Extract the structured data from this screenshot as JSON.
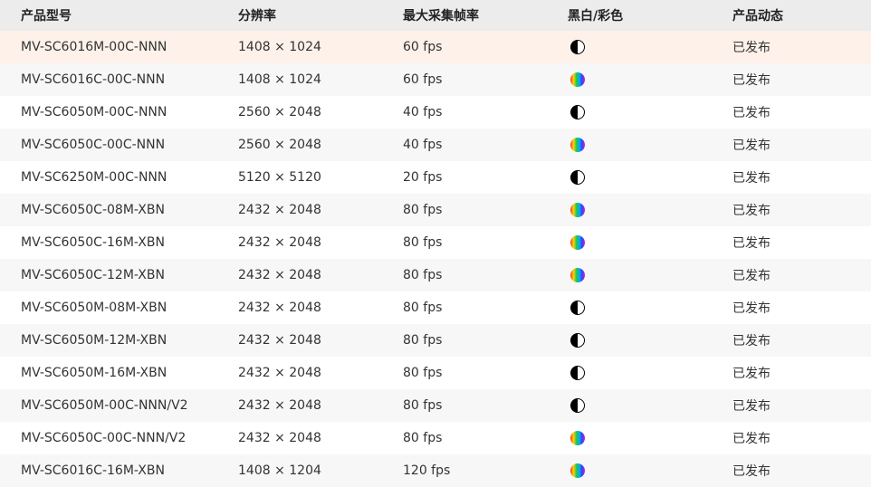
{
  "table": {
    "headers": {
      "model": "产品型号",
      "resolution": "分辨率",
      "fps": "最大采集帧率",
      "mode": "黑白/彩色",
      "status": "产品动态"
    },
    "rows": [
      {
        "model": "MV-SC6016M-00C-NNN",
        "resolution": "1408 × 1024",
        "fps": "60 fps",
        "mode_icon": "mono-icon",
        "status": "已发布"
      },
      {
        "model": "MV-SC6016C-00C-NNN",
        "resolution": "1408 × 1024",
        "fps": "60 fps",
        "mode_icon": "color-icon",
        "status": "已发布"
      },
      {
        "model": "MV-SC6050M-00C-NNN",
        "resolution": "2560 × 2048",
        "fps": "40 fps",
        "mode_icon": "mono-icon",
        "status": "已发布"
      },
      {
        "model": "MV-SC6050C-00C-NNN",
        "resolution": "2560 × 2048",
        "fps": "40 fps",
        "mode_icon": "color-icon",
        "status": "已发布"
      },
      {
        "model": "MV-SC6250M-00C-NNN",
        "resolution": "5120 × 5120",
        "fps": "20 fps",
        "mode_icon": "mono-icon",
        "status": "已发布"
      },
      {
        "model": "MV-SC6050C-08M-XBN",
        "resolution": "2432 × 2048",
        "fps": "80 fps",
        "mode_icon": "color-icon",
        "status": "已发布"
      },
      {
        "model": "MV-SC6050C-16M-XBN",
        "resolution": "2432 × 2048",
        "fps": "80 fps",
        "mode_icon": "color-icon",
        "status": "已发布"
      },
      {
        "model": "MV-SC6050C-12M-XBN",
        "resolution": "2432 × 2048",
        "fps": "80 fps",
        "mode_icon": "color-icon",
        "status": "已发布"
      },
      {
        "model": "MV-SC6050M-08M-XBN",
        "resolution": "2432 × 2048",
        "fps": "80 fps",
        "mode_icon": "mono-icon",
        "status": "已发布"
      },
      {
        "model": "MV-SC6050M-12M-XBN",
        "resolution": "2432 × 2048",
        "fps": "80 fps",
        "mode_icon": "mono-icon",
        "status": "已发布"
      },
      {
        "model": "MV-SC6050M-16M-XBN",
        "resolution": "2432 × 2048",
        "fps": "80 fps",
        "mode_icon": "mono-icon",
        "status": "已发布"
      },
      {
        "model": "MV-SC6050M-00C-NNN/V2",
        "resolution": "2432 × 2048",
        "fps": "80 fps",
        "mode_icon": "mono-icon",
        "status": "已发布"
      },
      {
        "model": "MV-SC6050C-00C-NNN/V2",
        "resolution": "2432 × 2048",
        "fps": "80 fps",
        "mode_icon": "color-icon",
        "status": "已发布"
      },
      {
        "model": "MV-SC6016C-16M-XBN",
        "resolution": "1408 × 1204",
        "fps": "120 fps",
        "mode_icon": "color-icon",
        "status": "已发布"
      }
    ],
    "highlighted_row": 0
  },
  "colors": {
    "header_bg": "#ececec",
    "row_alt_bg": "#f7f7f7",
    "row_highlight_bg": "#fdf1ea"
  }
}
